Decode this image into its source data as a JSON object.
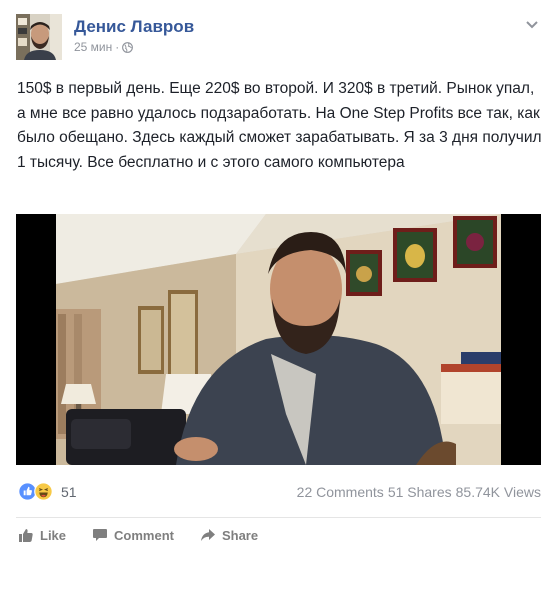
{
  "post": {
    "author": "Денис Лавров",
    "time": "25 мин",
    "separator": "·",
    "text": "150$ в первый день. Еще 220$ во второй. И 320$ в третий. Рынок упал, а мне все равно удалось подзаработать. На One Step Profits все так, как было обещано. Здесь каждый сможет зарабатывать. Я за 3 дня получил 1 тысячу. Все бесплатно и с этого самого компьютера"
  },
  "stats": {
    "reaction_count": "51",
    "comments": "22 Comments",
    "shares": "51 Shares",
    "views": "85.74K Views"
  },
  "actions": {
    "like": "Like",
    "comment": "Comment",
    "share": "Share"
  },
  "icons": {
    "privacy": "globe-icon",
    "menu": "chevron-down-icon",
    "reaction_1": "like-reaction-icon",
    "reaction_2": "haha-reaction-icon",
    "like": "thumbs-up-icon",
    "comment": "comment-bubble-icon",
    "share": "share-arrow-icon"
  },
  "colors": {
    "author_link": "#365899",
    "muted": "#90949c",
    "like_blue": "#5890ff",
    "haha_yellow": "#f7c946"
  }
}
